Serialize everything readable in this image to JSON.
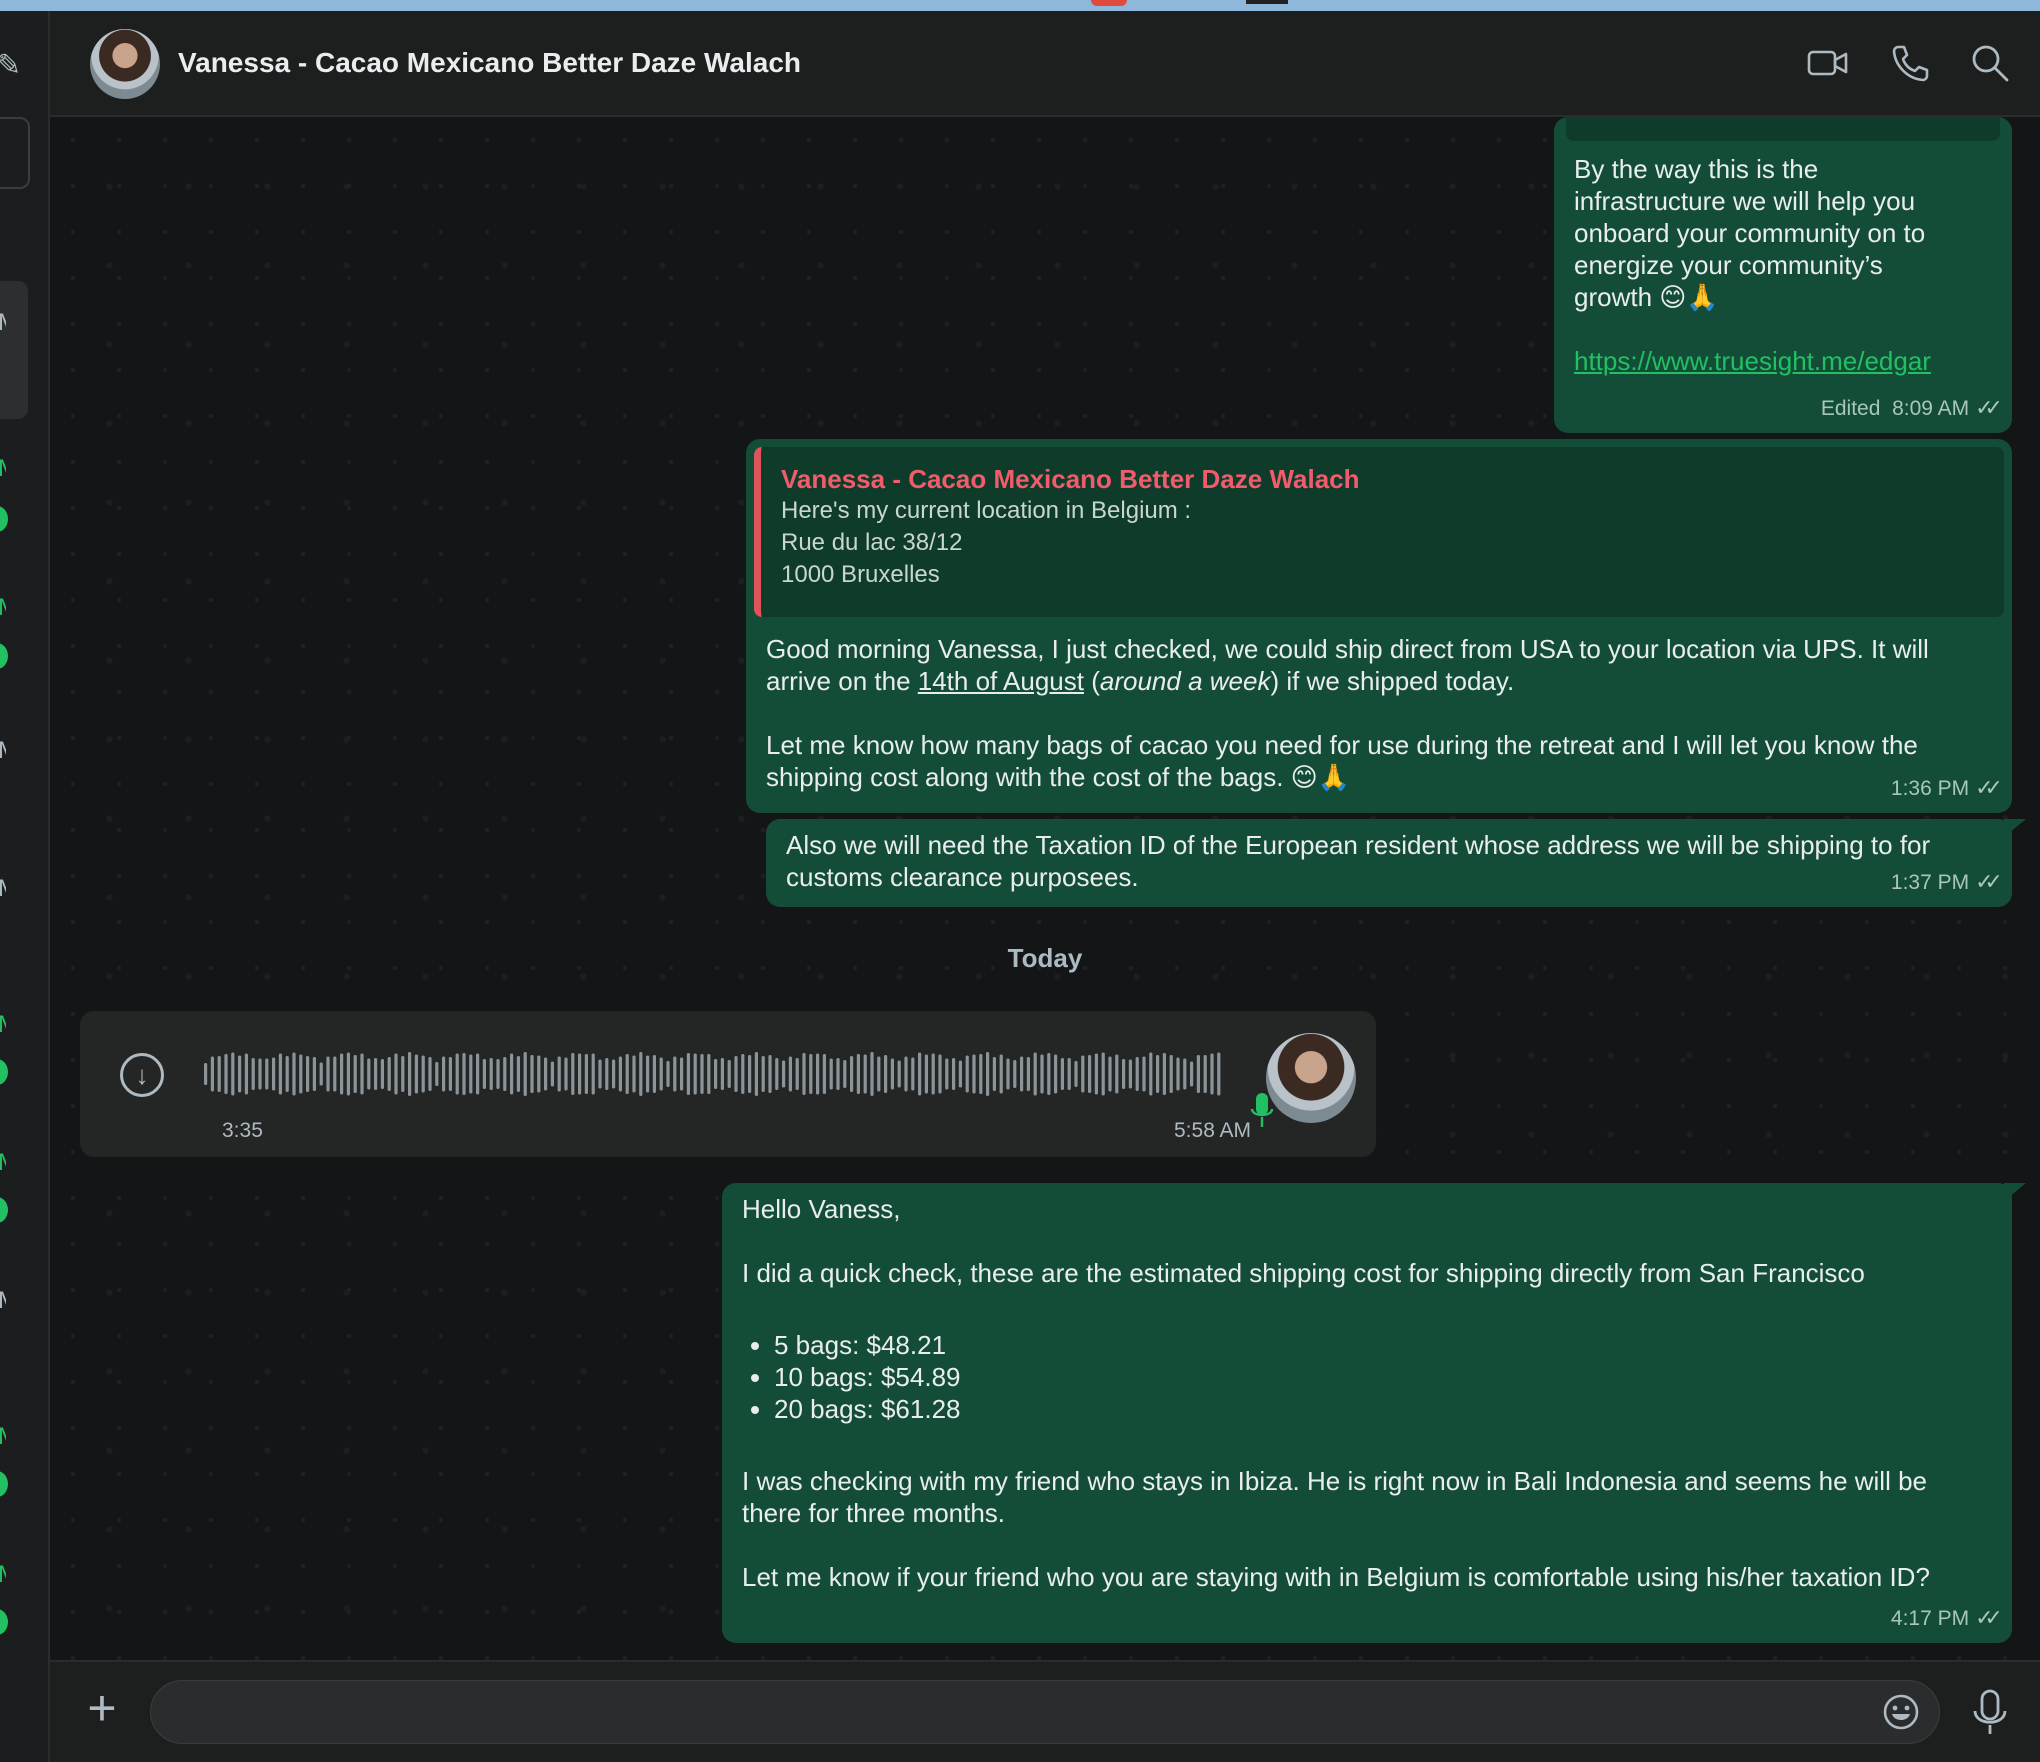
{
  "header": {
    "contact_name": "Vanessa - Cacao Mexicano Better Daze Walach",
    "icons": [
      "video-call-icon",
      "voice-call-icon",
      "search-icon"
    ]
  },
  "messages": {
    "m1": {
      "lines": [
        "By the way this is the",
        "infrastructure we will help you",
        "onboard your community on to",
        "energize your community’s",
        "growth 😊🙏"
      ],
      "link": "https://www.truesight.me/edgar",
      "edited": "Edited",
      "time": "8:09 AM"
    },
    "m2": {
      "quote_name": "Vanessa - Cacao Mexicano Better Daze Walach",
      "quote_lines": [
        "Here's my current location in Belgium :",
        "Rue du lac 38/12",
        "1000 Bruxelles"
      ],
      "p1_a": "Good morning Vanessa, I just checked, we could ship direct from USA to your location via UPS. It will arrive on the ",
      "p1_link": "14th of August",
      "p1_b": " (",
      "p1_em": "around a week",
      "p1_c": ") if we shipped today.",
      "p2": "Let me know how many bags of cacao you need for use during the retreat and I will let you know the shipping cost along with the cost of the bags. 😊🙏",
      "time": "1:36 PM"
    },
    "m3": {
      "text": "Also we will need the Taxation ID of the European resident whose address we will be shipping to for customs clearance purposees.",
      "time": "1:37 PM"
    },
    "date_divider": "Today",
    "voice": {
      "duration": "3:35",
      "time": "5:58 AM"
    },
    "m4": {
      "greeting": "Hello Vaness,",
      "intro": "I did a quick check, these are the estimated shipping cost for shipping directly from San Francisco",
      "items": [
        "5 bags: $48.21",
        "10 bags: $54.89",
        "20 bags: $61.28"
      ],
      "p3": "I was checking with my friend who stays in Ibiza. He is right now in Bali Indonesia and seems he will be there for three months.",
      "p4": "Let me know if your friend who you are staying with in Belgium is comfortable using his/her taxation ID?",
      "time": "4:17 PM"
    }
  },
  "composer": {
    "value": "",
    "placeholder": ""
  },
  "colors": {
    "accent": "#21c063",
    "bubble_out": "#144d37",
    "quote_bar": "#e0535a",
    "quote_name": "#f15c6d",
    "background": "#141516"
  }
}
